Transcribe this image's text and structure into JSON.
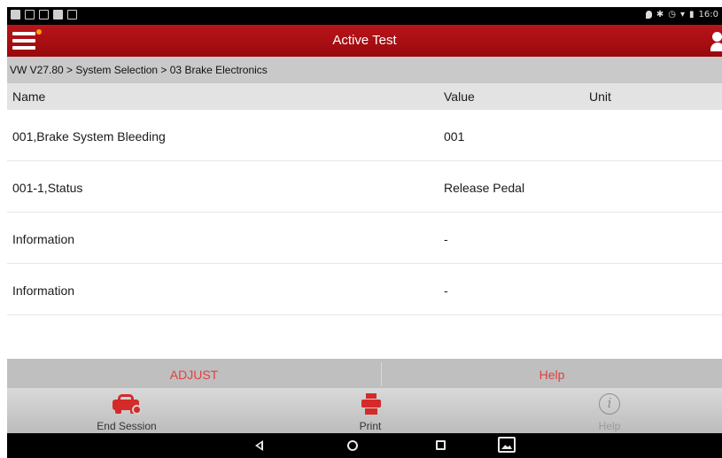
{
  "status_bar": {
    "time": "16:0",
    "left_icons": [
      "notification-icon",
      "message-icon",
      "voicemail-icon",
      "notification-icon",
      "screenshot-icon"
    ],
    "right_icons": [
      "location-icon",
      "bluetooth-icon",
      "alarm-icon",
      "wifi-icon",
      "battery-icon"
    ]
  },
  "header": {
    "title": "Active Test",
    "menu_icon": "hamburger-menu-icon",
    "user_icon": "user-icon",
    "color": "#a80f14"
  },
  "breadcrumb": "VW V27.80 > System Selection > 03 Brake Electronics",
  "table": {
    "columns": [
      "Name",
      "Value",
      "Unit"
    ],
    "rows": [
      {
        "name": "001,Brake System Bleeding",
        "value": "001",
        "unit": ""
      },
      {
        "name": "001-1,Status",
        "value": "Release Pedal",
        "unit": ""
      },
      {
        "name": "Information",
        "value": "-",
        "unit": ""
      },
      {
        "name": "Information",
        "value": "-",
        "unit": ""
      }
    ]
  },
  "actions": {
    "adjust": "ADJUST",
    "help": "Help",
    "color": "#e04040"
  },
  "toolbar": {
    "end_session": {
      "label": "End Session",
      "icon": "car-check-icon"
    },
    "print": {
      "label": "Print",
      "icon": "printer-icon"
    },
    "help": {
      "label": "Help",
      "icon": "info-icon"
    }
  },
  "nav_bar": {
    "buttons": [
      "back-icon",
      "home-icon",
      "recent-apps-icon",
      "screenshot-icon"
    ]
  }
}
